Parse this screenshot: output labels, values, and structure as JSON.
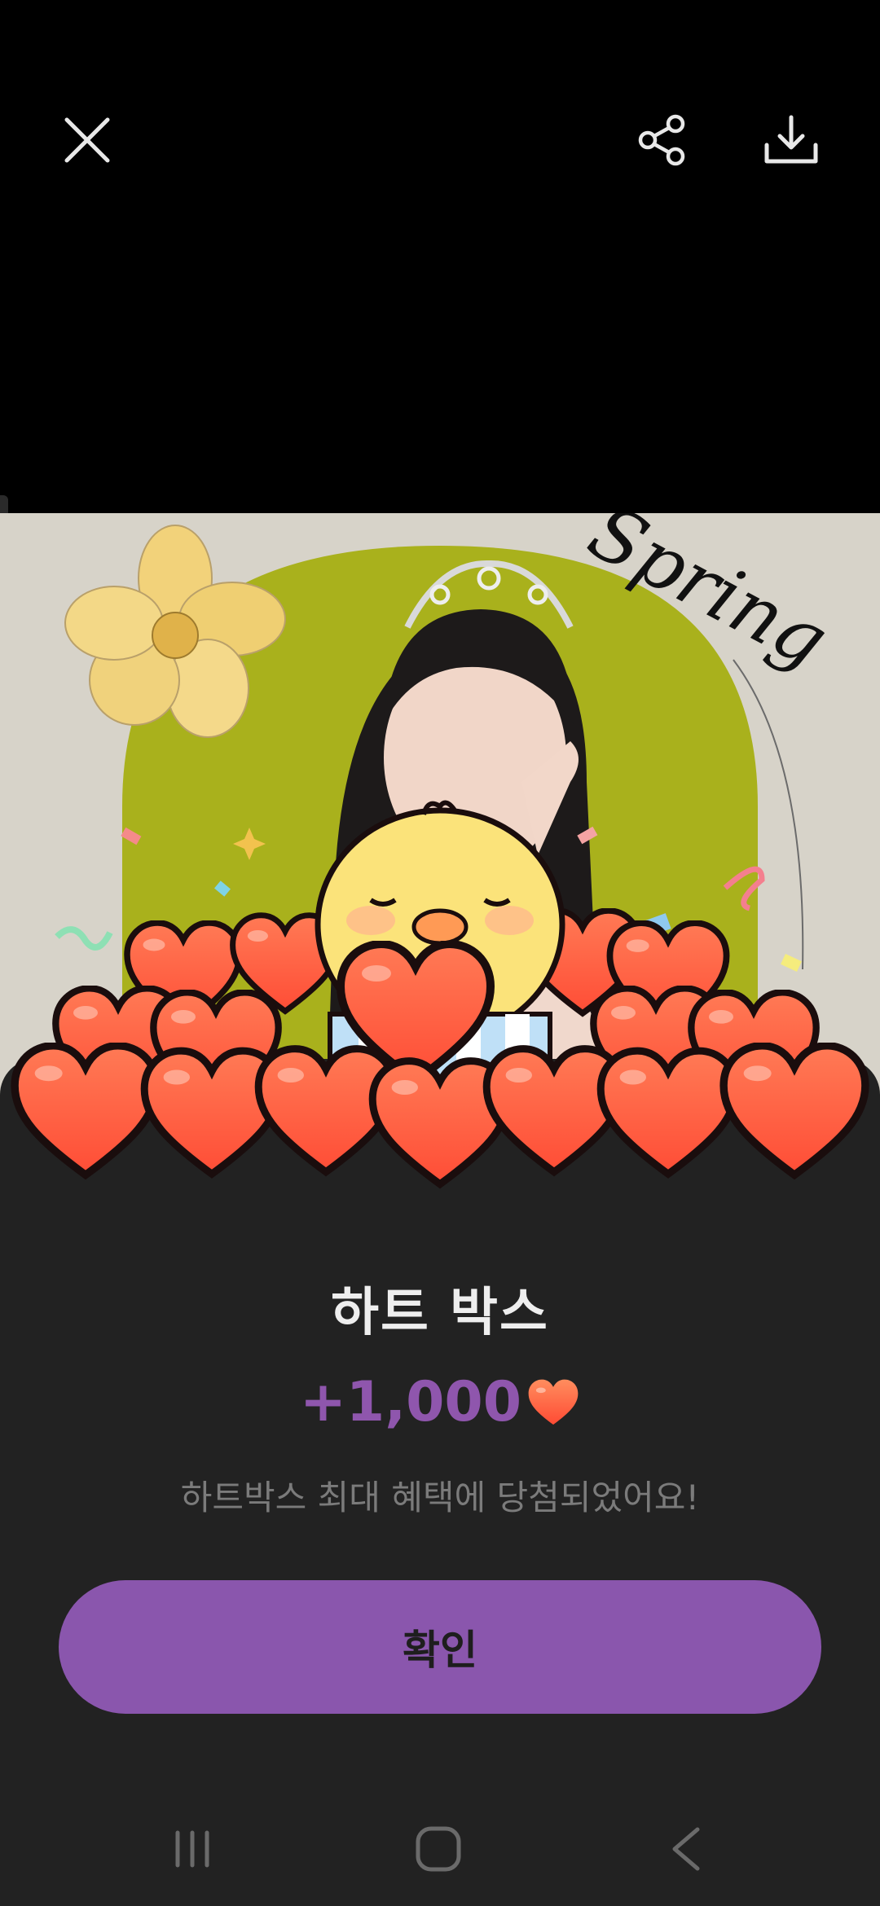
{
  "header": {
    "close_icon": "close-icon",
    "share_icon": "share-icon",
    "download_icon": "download-icon"
  },
  "photo": {
    "overlay_text": "Spring"
  },
  "reward": {
    "title": "하트 박스",
    "amount": "+1,000",
    "currency_icon": "heart-icon",
    "message": "하트박스 최대 혜택에 당첨되었어요!",
    "confirm_label": "확인"
  },
  "colors": {
    "accent": "#8a56ad",
    "amount_text": "#8f56ad",
    "sheet_bg": "#222222",
    "heart": "#ff6a47"
  },
  "system_nav": {
    "recents_icon": "recents-icon",
    "home_icon": "home-icon",
    "back_icon": "back-icon"
  }
}
